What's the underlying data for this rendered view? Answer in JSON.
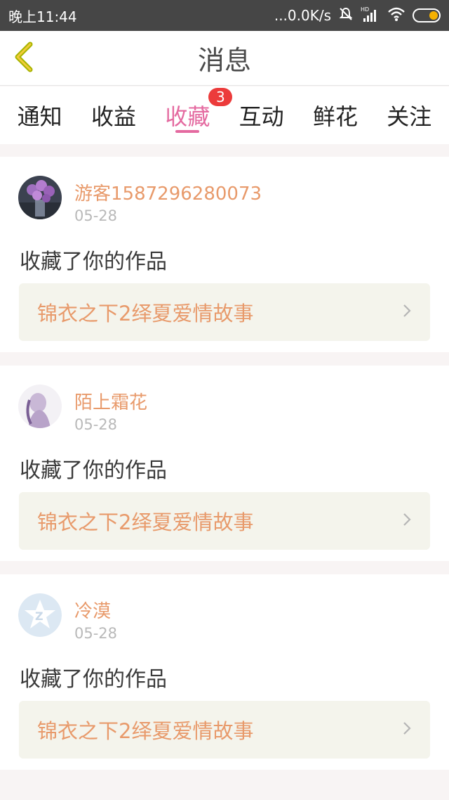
{
  "status_bar": {
    "time": "晚上11:44",
    "netspeed": "...0.0K/s",
    "network_label": "HD",
    "icons": [
      "mute-icon",
      "signal-icon",
      "wifi-icon",
      "battery-icon"
    ]
  },
  "header": {
    "title": "消息",
    "back_icon": "chevron-left-icon"
  },
  "tabs": [
    {
      "label": "通知"
    },
    {
      "label": "收益"
    },
    {
      "label": "收藏",
      "active": true,
      "badge": "3"
    },
    {
      "label": "互动"
    },
    {
      "label": "鲜花"
    },
    {
      "label": "关注"
    }
  ],
  "colors": {
    "accent": "#e46aa0",
    "username": "#e89a6b",
    "badge": "#ec3b3b",
    "status_bar": "#464646",
    "work_box": "#f4f4ec"
  },
  "messages": [
    {
      "username": "游客1587296280073",
      "date": "05-28",
      "action": "收藏了你的作品",
      "work_title": "锦衣之下2绎夏爱情故事",
      "avatar": "roses-avatar"
    },
    {
      "username": "陌上霜花",
      "date": "05-28",
      "action": "收藏了你的作品",
      "work_title": "锦衣之下2绎夏爱情故事",
      "avatar": "girl-avatar"
    },
    {
      "username": "冷漠",
      "date": "05-28",
      "action": "收藏了你的作品",
      "work_title": "锦衣之下2绎夏爱情故事",
      "avatar": "qq-star-avatar"
    }
  ]
}
